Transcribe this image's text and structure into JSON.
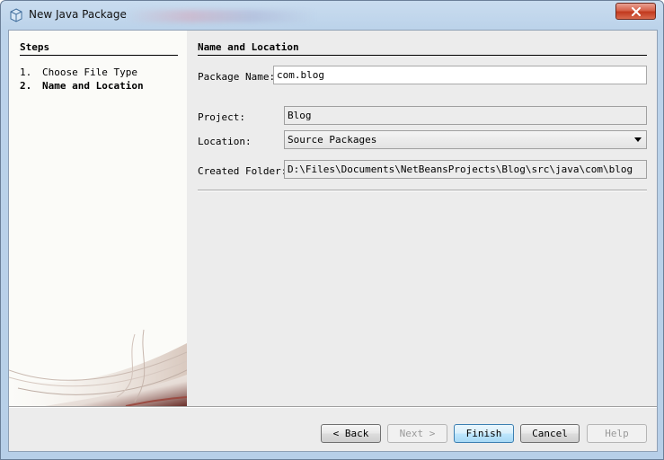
{
  "window": {
    "title": "New Java Package",
    "close_icon": "close-icon"
  },
  "steps": {
    "title": "Steps",
    "items": [
      {
        "number": "1.",
        "label": "Choose File Type",
        "current": false
      },
      {
        "number": "2.",
        "label": "Name and Location",
        "current": true
      }
    ]
  },
  "form": {
    "section_title": "Name and Location",
    "package_name": {
      "label": "Package Name:",
      "value": "com.blog"
    },
    "project": {
      "label": "Project:",
      "value": "Blog"
    },
    "location": {
      "label": "Location:",
      "value": "Source Packages"
    },
    "created_folder": {
      "label": "Created Folder:",
      "value": "D:\\Files\\Documents\\NetBeansProjects\\Blog\\src\\java\\com\\blog"
    }
  },
  "buttons": {
    "back": "< Back",
    "next": "Next >",
    "finish": "Finish",
    "cancel": "Cancel",
    "help": "Help"
  },
  "colors": {
    "titlebar": "#c9dcef",
    "close_button": "#c2391e",
    "panel_background": "#ececec",
    "steps_background": "#fbfbf8"
  }
}
